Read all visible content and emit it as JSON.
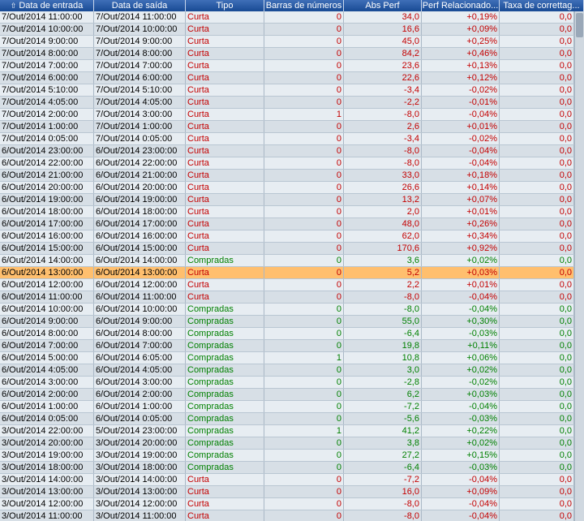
{
  "colors": {
    "header_bg": "#184a94",
    "row_even": "#e7edf2",
    "row_odd": "#d7dfe6",
    "selected_row": "#ffbf6e",
    "short_text": "#c40000",
    "long_text": "#008000"
  },
  "header": {
    "sort_icon": "sort-ascending-icon",
    "columns": [
      "Data de entrada",
      "Data de saída",
      "Tipo",
      "Barras de números",
      "Abs Perf",
      "Perf Relacionado...",
      "Taxa de correttag..."
    ]
  },
  "selected_index": 21,
  "rows": [
    {
      "entry": "7/Out/2014 11:00:00",
      "exit": "7/Out/2014 11:00:00",
      "type": "Curta",
      "bars": "0",
      "abs": "34,0",
      "rel": "+0,19%",
      "comm": "0,0"
    },
    {
      "entry": "7/Out/2014 10:00:00",
      "exit": "7/Out/2014 10:00:00",
      "type": "Curta",
      "bars": "0",
      "abs": "16,6",
      "rel": "+0,09%",
      "comm": "0,0"
    },
    {
      "entry": "7/Out/2014 9:00:00",
      "exit": "7/Out/2014 9:00:00",
      "type": "Curta",
      "bars": "0",
      "abs": "45,0",
      "rel": "+0,25%",
      "comm": "0,0"
    },
    {
      "entry": "7/Out/2014 8:00:00",
      "exit": "7/Out/2014 8:00:00",
      "type": "Curta",
      "bars": "0",
      "abs": "84,2",
      "rel": "+0,46%",
      "comm": "0,0"
    },
    {
      "entry": "7/Out/2014 7:00:00",
      "exit": "7/Out/2014 7:00:00",
      "type": "Curta",
      "bars": "0",
      "abs": "23,6",
      "rel": "+0,13%",
      "comm": "0,0"
    },
    {
      "entry": "7/Out/2014 6:00:00",
      "exit": "7/Out/2014 6:00:00",
      "type": "Curta",
      "bars": "0",
      "abs": "22,6",
      "rel": "+0,12%",
      "comm": "0,0"
    },
    {
      "entry": "7/Out/2014 5:10:00",
      "exit": "7/Out/2014 5:10:00",
      "type": "Curta",
      "bars": "0",
      "abs": "-3,4",
      "rel": "-0,02%",
      "comm": "0,0"
    },
    {
      "entry": "7/Out/2014 4:05:00",
      "exit": "7/Out/2014 4:05:00",
      "type": "Curta",
      "bars": "0",
      "abs": "-2,2",
      "rel": "-0,01%",
      "comm": "0,0"
    },
    {
      "entry": "7/Out/2014 2:00:00",
      "exit": "7/Out/2014 3:00:00",
      "type": "Curta",
      "bars": "1",
      "abs": "-8,0",
      "rel": "-0,04%",
      "comm": "0,0"
    },
    {
      "entry": "7/Out/2014 1:00:00",
      "exit": "7/Out/2014 1:00:00",
      "type": "Curta",
      "bars": "0",
      "abs": "2,6",
      "rel": "+0,01%",
      "comm": "0,0"
    },
    {
      "entry": "7/Out/2014 0:05:00",
      "exit": "7/Out/2014 0:05:00",
      "type": "Curta",
      "bars": "0",
      "abs": "-3,4",
      "rel": "-0,02%",
      "comm": "0,0"
    },
    {
      "entry": "6/Out/2014 23:00:00",
      "exit": "6/Out/2014 23:00:00",
      "type": "Curta",
      "bars": "0",
      "abs": "-8,0",
      "rel": "-0,04%",
      "comm": "0,0"
    },
    {
      "entry": "6/Out/2014 22:00:00",
      "exit": "6/Out/2014 22:00:00",
      "type": "Curta",
      "bars": "0",
      "abs": "-8,0",
      "rel": "-0,04%",
      "comm": "0,0"
    },
    {
      "entry": "6/Out/2014 21:00:00",
      "exit": "6/Out/2014 21:00:00",
      "type": "Curta",
      "bars": "0",
      "abs": "33,0",
      "rel": "+0,18%",
      "comm": "0,0"
    },
    {
      "entry": "6/Out/2014 20:00:00",
      "exit": "6/Out/2014 20:00:00",
      "type": "Curta",
      "bars": "0",
      "abs": "26,6",
      "rel": "+0,14%",
      "comm": "0,0"
    },
    {
      "entry": "6/Out/2014 19:00:00",
      "exit": "6/Out/2014 19:00:00",
      "type": "Curta",
      "bars": "0",
      "abs": "13,2",
      "rel": "+0,07%",
      "comm": "0,0"
    },
    {
      "entry": "6/Out/2014 18:00:00",
      "exit": "6/Out/2014 18:00:00",
      "type": "Curta",
      "bars": "0",
      "abs": "2,0",
      "rel": "+0,01%",
      "comm": "0,0"
    },
    {
      "entry": "6/Out/2014 17:00:00",
      "exit": "6/Out/2014 17:00:00",
      "type": "Curta",
      "bars": "0",
      "abs": "48,0",
      "rel": "+0,26%",
      "comm": "0,0"
    },
    {
      "entry": "6/Out/2014 16:00:00",
      "exit": "6/Out/2014 16:00:00",
      "type": "Curta",
      "bars": "0",
      "abs": "62,0",
      "rel": "+0,34%",
      "comm": "0,0"
    },
    {
      "entry": "6/Out/2014 15:00:00",
      "exit": "6/Out/2014 15:00:00",
      "type": "Curta",
      "bars": "0",
      "abs": "170,6",
      "rel": "+0,92%",
      "comm": "0,0"
    },
    {
      "entry": "6/Out/2014 14:00:00",
      "exit": "6/Out/2014 14:00:00",
      "type": "Compradas",
      "bars": "0",
      "abs": "3,6",
      "rel": "+0,02%",
      "comm": "0,0"
    },
    {
      "entry": "6/Out/2014 13:00:00",
      "exit": "6/Out/2014 13:00:00",
      "type": "Curta",
      "bars": "0",
      "abs": "5,2",
      "rel": "+0,03%",
      "comm": "0,0"
    },
    {
      "entry": "6/Out/2014 12:00:00",
      "exit": "6/Out/2014 12:00:00",
      "type": "Curta",
      "bars": "0",
      "abs": "2,2",
      "rel": "+0,01%",
      "comm": "0,0"
    },
    {
      "entry": "6/Out/2014 11:00:00",
      "exit": "6/Out/2014 11:00:00",
      "type": "Curta",
      "bars": "0",
      "abs": "-8,0",
      "rel": "-0,04%",
      "comm": "0,0"
    },
    {
      "entry": "6/Out/2014 10:00:00",
      "exit": "6/Out/2014 10:00:00",
      "type": "Compradas",
      "bars": "0",
      "abs": "-8,0",
      "rel": "-0,04%",
      "comm": "0,0"
    },
    {
      "entry": "6/Out/2014 9:00:00",
      "exit": "6/Out/2014 9:00:00",
      "type": "Compradas",
      "bars": "0",
      "abs": "55,0",
      "rel": "+0,30%",
      "comm": "0,0"
    },
    {
      "entry": "6/Out/2014 8:00:00",
      "exit": "6/Out/2014 8:00:00",
      "type": "Compradas",
      "bars": "0",
      "abs": "-6,4",
      "rel": "-0,03%",
      "comm": "0,0"
    },
    {
      "entry": "6/Out/2014 7:00:00",
      "exit": "6/Out/2014 7:00:00",
      "type": "Compradas",
      "bars": "0",
      "abs": "19,8",
      "rel": "+0,11%",
      "comm": "0,0"
    },
    {
      "entry": "6/Out/2014 5:00:00",
      "exit": "6/Out/2014 6:05:00",
      "type": "Compradas",
      "bars": "1",
      "abs": "10,8",
      "rel": "+0,06%",
      "comm": "0,0"
    },
    {
      "entry": "6/Out/2014 4:05:00",
      "exit": "6/Out/2014 4:05:00",
      "type": "Compradas",
      "bars": "0",
      "abs": "3,0",
      "rel": "+0,02%",
      "comm": "0,0"
    },
    {
      "entry": "6/Out/2014 3:00:00",
      "exit": "6/Out/2014 3:00:00",
      "type": "Compradas",
      "bars": "0",
      "abs": "-2,8",
      "rel": "-0,02%",
      "comm": "0,0"
    },
    {
      "entry": "6/Out/2014 2:00:00",
      "exit": "6/Out/2014 2:00:00",
      "type": "Compradas",
      "bars": "0",
      "abs": "6,2",
      "rel": "+0,03%",
      "comm": "0,0"
    },
    {
      "entry": "6/Out/2014 1:00:00",
      "exit": "6/Out/2014 1:00:00",
      "type": "Compradas",
      "bars": "0",
      "abs": "-7,2",
      "rel": "-0,04%",
      "comm": "0,0"
    },
    {
      "entry": "6/Out/2014 0:05:00",
      "exit": "6/Out/2014 0:05:00",
      "type": "Compradas",
      "bars": "0",
      "abs": "-5,6",
      "rel": "-0,03%",
      "comm": "0,0"
    },
    {
      "entry": "3/Out/2014 22:00:00",
      "exit": "5/Out/2014 23:00:00",
      "type": "Compradas",
      "bars": "1",
      "abs": "41,2",
      "rel": "+0,22%",
      "comm": "0,0"
    },
    {
      "entry": "3/Out/2014 20:00:00",
      "exit": "3/Out/2014 20:00:00",
      "type": "Compradas",
      "bars": "0",
      "abs": "3,8",
      "rel": "+0,02%",
      "comm": "0,0"
    },
    {
      "entry": "3/Out/2014 19:00:00",
      "exit": "3/Out/2014 19:00:00",
      "type": "Compradas",
      "bars": "0",
      "abs": "27,2",
      "rel": "+0,15%",
      "comm": "0,0"
    },
    {
      "entry": "3/Out/2014 18:00:00",
      "exit": "3/Out/2014 18:00:00",
      "type": "Compradas",
      "bars": "0",
      "abs": "-6,4",
      "rel": "-0,03%",
      "comm": "0,0"
    },
    {
      "entry": "3/Out/2014 14:00:00",
      "exit": "3/Out/2014 14:00:00",
      "type": "Curta",
      "bars": "0",
      "abs": "-7,2",
      "rel": "-0,04%",
      "comm": "0,0"
    },
    {
      "entry": "3/Out/2014 13:00:00",
      "exit": "3/Out/2014 13:00:00",
      "type": "Curta",
      "bars": "0",
      "abs": "16,0",
      "rel": "+0,09%",
      "comm": "0,0"
    },
    {
      "entry": "3/Out/2014 12:00:00",
      "exit": "3/Out/2014 12:00:00",
      "type": "Curta",
      "bars": "0",
      "abs": "-8,0",
      "rel": "-0,04%",
      "comm": "0,0"
    },
    {
      "entry": "3/Out/2014 11:00:00",
      "exit": "3/Out/2014 11:00:00",
      "type": "Curta",
      "bars": "0",
      "abs": "-8,0",
      "rel": "-0,04%",
      "comm": "0,0"
    }
  ]
}
